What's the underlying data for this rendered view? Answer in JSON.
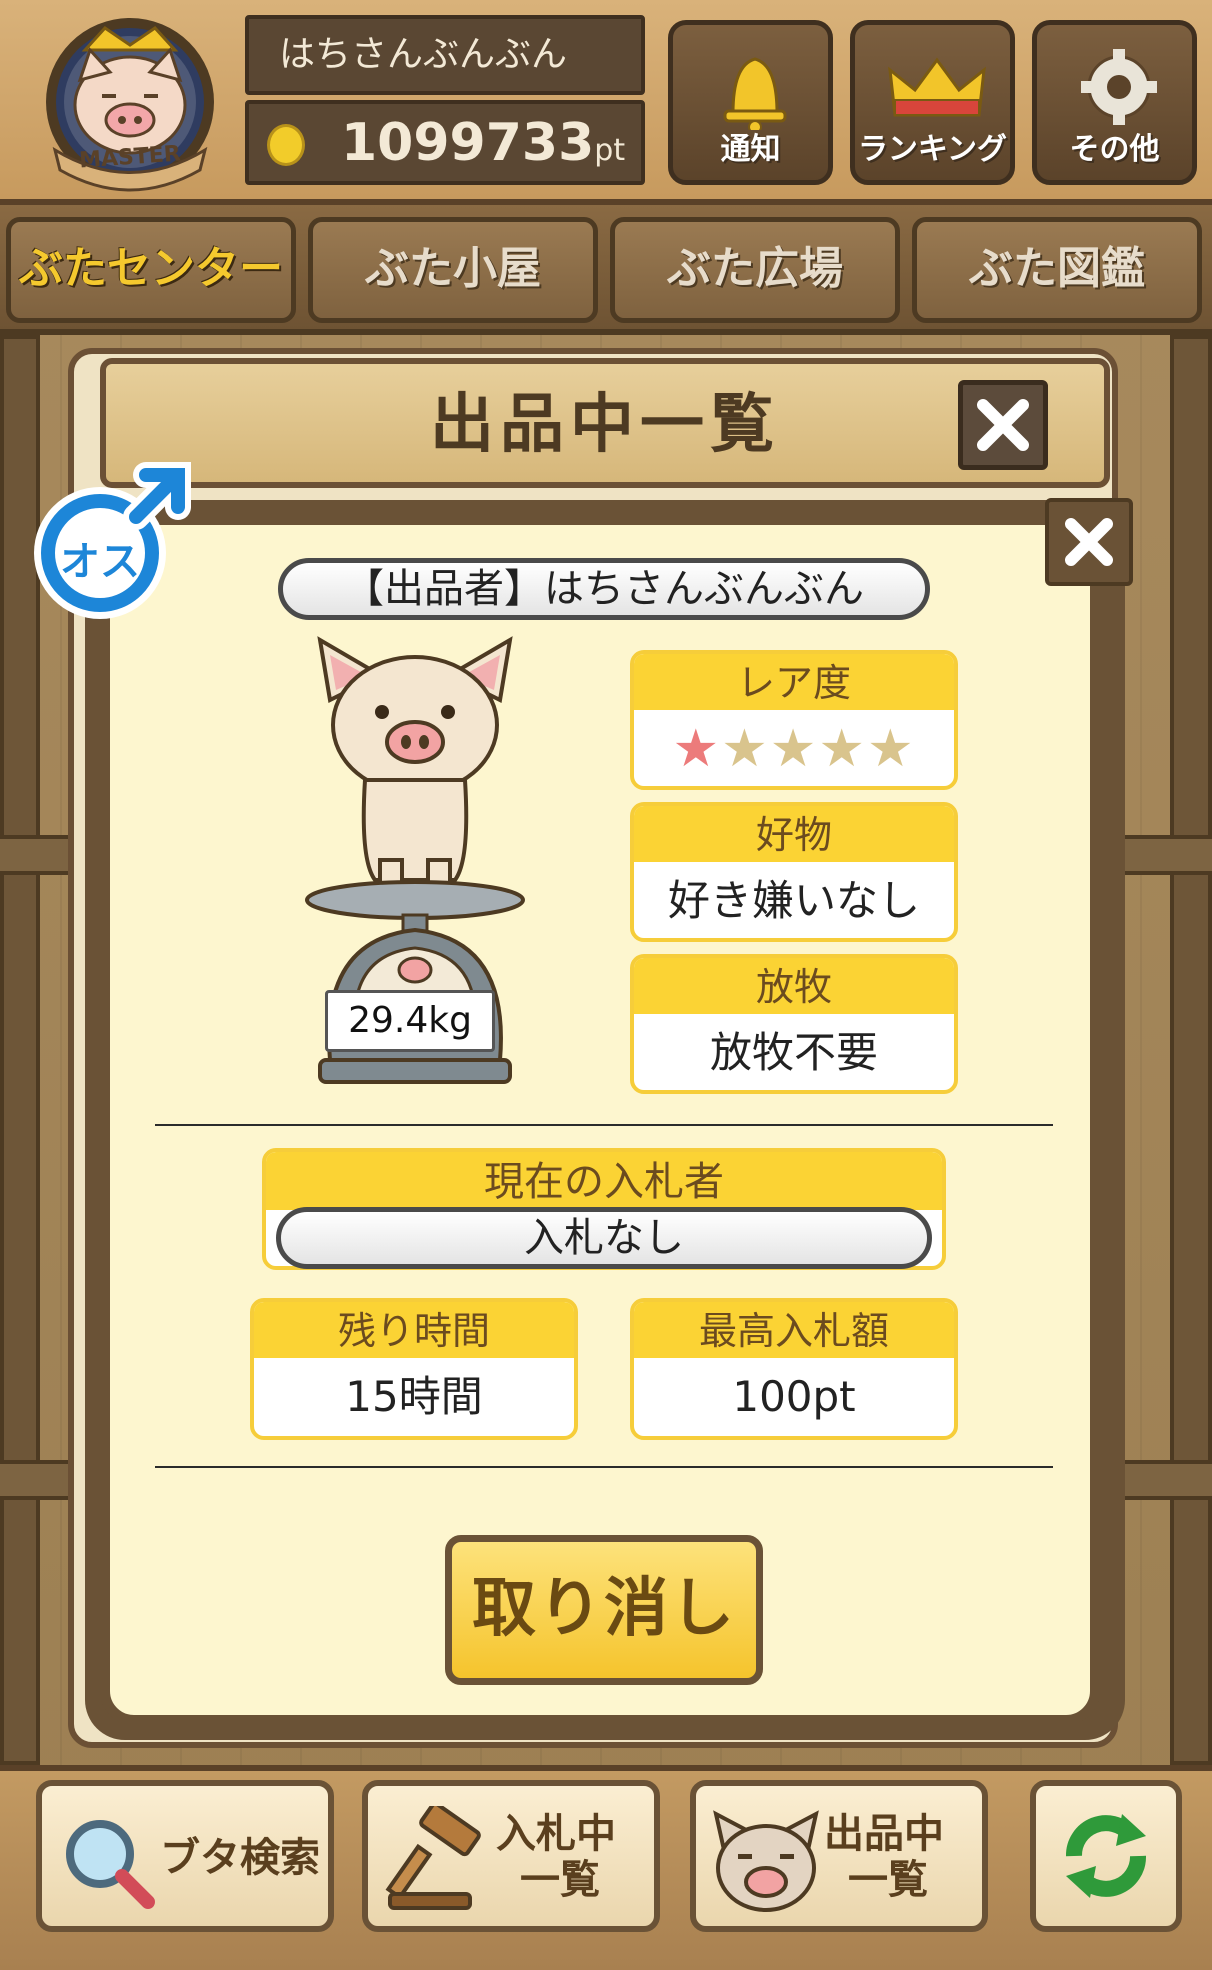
{
  "header": {
    "badge_text": "MASTER",
    "user_name": "はちさんぶんぶん",
    "points": "1099733",
    "points_unit": "pt",
    "buttons": [
      {
        "label": "通知",
        "icon": "bell-icon"
      },
      {
        "label": "ランキング",
        "icon": "crown-icon"
      },
      {
        "label": "その他",
        "icon": "gear-icon"
      }
    ]
  },
  "nav": {
    "tabs": [
      {
        "label": "ぶたセンター",
        "active": true
      },
      {
        "label": "ぶた小屋",
        "active": false
      },
      {
        "label": "ぶた広場",
        "active": false
      },
      {
        "label": "ぶた図鑑",
        "active": false
      }
    ]
  },
  "listing_panel": {
    "title": "出品中一覧"
  },
  "detail": {
    "gender_label": "オス",
    "seller_label": "【出品者】はちさんぶんぶん",
    "weight": "29.4kg",
    "rarity": {
      "label": "レア度",
      "stars_filled": 1,
      "stars_total": 5
    },
    "favorite": {
      "label": "好物",
      "value": "好き嫌いなし"
    },
    "grazing": {
      "label": "放牧",
      "value": "放牧不要"
    },
    "current_bidder": {
      "label": "現在の入札者",
      "value": "入札なし"
    },
    "time_left": {
      "label": "残り時間",
      "value": "15時間"
    },
    "highest_bid": {
      "label": "最高入札額",
      "value": "100pt"
    },
    "cancel_label": "取り消し"
  },
  "bottom_bar": {
    "search_label": "ブタ検索",
    "bidding_label_1": "入札中",
    "bidding_label_2": "一覧",
    "listing_label_1": "出品中",
    "listing_label_2": "一覧",
    "refresh_icon": "refresh-icon"
  },
  "colors": {
    "accent_yellow": "#fbd334",
    "wood_dark": "#6a5236",
    "star_on": "#ec7b7b",
    "star_off": "#d9c48d"
  }
}
